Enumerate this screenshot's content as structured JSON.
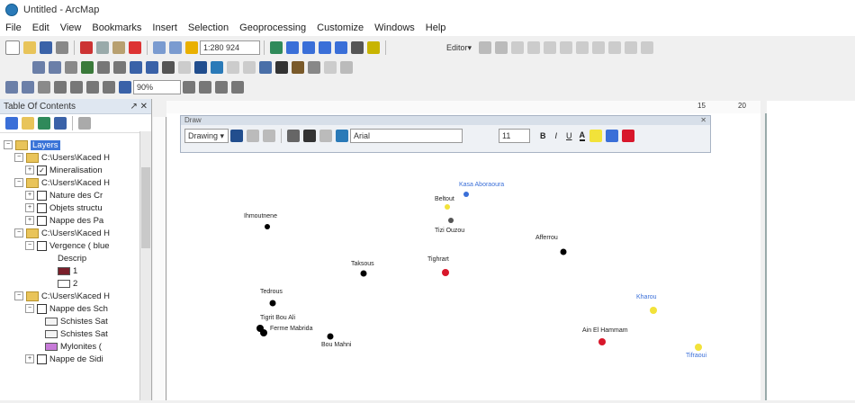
{
  "window": {
    "title": "Untitled - ArcMap"
  },
  "menu": [
    "File",
    "Edit",
    "View",
    "Bookmarks",
    "Insert",
    "Selection",
    "Geoprocessing",
    "Customize",
    "Windows",
    "Help"
  ],
  "toolbar": {
    "scale_value": "1:280 924",
    "editor_label": "Editor▾",
    "zoom_value": "90%"
  },
  "toc": {
    "title": "Table Of Contents",
    "pin": "↗ ✕",
    "items": [
      {
        "label": "Layers",
        "level": 0,
        "type": "dataframe"
      },
      {
        "label": "C:\\Users\\Kaced H",
        "level": 1,
        "type": "folder"
      },
      {
        "label": "Mineralisation",
        "level": 2,
        "type": "layer",
        "checked": true
      },
      {
        "label": "C:\\Users\\Kaced H",
        "level": 1,
        "type": "folder"
      },
      {
        "label": "Nature des Cr",
        "level": 2,
        "type": "layer",
        "checked": false
      },
      {
        "label": "Objets structu",
        "level": 2,
        "type": "layer",
        "checked": false
      },
      {
        "label": "Nappe des Pa",
        "level": 2,
        "type": "layer",
        "checked": false
      },
      {
        "label": "C:\\Users\\Kaced H",
        "level": 1,
        "type": "folder"
      },
      {
        "label": "Vergence ( blue",
        "level": 2,
        "type": "layer",
        "checked": false
      },
      {
        "label": "Descrip",
        "level": 3,
        "type": "text"
      },
      {
        "label": "1",
        "level": 3,
        "type": "swatch",
        "color": "#7a1f2a"
      },
      {
        "label": "2",
        "level": 3,
        "type": "swatch",
        "color": "#ffffff"
      },
      {
        "label": "C:\\Users\\Kaced H",
        "level": 1,
        "type": "folder"
      },
      {
        "label": "Nappe des Sch",
        "level": 2,
        "type": "layer",
        "checked": false
      },
      {
        "label": "Schistes Sat",
        "level": 3,
        "type": "swatch",
        "color": "#f4f4f4"
      },
      {
        "label": "Schistes Sat",
        "level": 3,
        "type": "swatch",
        "color": "#f4f4f4"
      },
      {
        "label": "Mylonites (",
        "level": 3,
        "type": "swatch",
        "color": "#c77bd8"
      },
      {
        "label": "Nappe de Sidi",
        "level": 2,
        "type": "layer",
        "checked": false
      }
    ]
  },
  "drawing_toolbar": {
    "title": "Draw",
    "drawing_label": "Drawing ▾",
    "font_name": "Arial",
    "font_size": "11",
    "bold": "B",
    "italic": "I",
    "underline": "U",
    "font_color": "A"
  },
  "ruler_numbers": [
    "15",
    "20"
  ],
  "map_points": [
    {
      "label": "Ihmoutnene",
      "color": "#000000",
      "label_color": "black"
    },
    {
      "label": "Kasa Aboraoura",
      "color": "#3a6fd8",
      "label_color": "blue"
    },
    {
      "label": "Beltout",
      "color": "#f2e23a",
      "label_color": "black"
    },
    {
      "label": "Tizi Ouzou",
      "color": "#555555",
      "label_color": "black"
    },
    {
      "label": "Taksous",
      "color": "#000000",
      "label_color": "black"
    },
    {
      "label": "Tighrart",
      "color": "#d8172b",
      "label_color": "black"
    },
    {
      "label": "Afferrou",
      "color": "#000000",
      "label_color": "black"
    },
    {
      "label": "Tedrous",
      "color": "#000000",
      "label_color": "black"
    },
    {
      "label": "Tigrit Bou Ali",
      "color": "#000000",
      "label_color": "black"
    },
    {
      "label": "Ferme Mabrida",
      "color": "#000000",
      "label_color": "black"
    },
    {
      "label": "Bou Mahni",
      "color": "#000000",
      "label_color": "black"
    },
    {
      "label": "Ain El Hammam",
      "color": "#d8172b",
      "label_color": "black"
    },
    {
      "label": "Kharou",
      "color": "#f2e23a",
      "label_color": "blue"
    },
    {
      "label": "Tifraoui",
      "color": "#f2e23a",
      "label_color": "blue"
    }
  ]
}
